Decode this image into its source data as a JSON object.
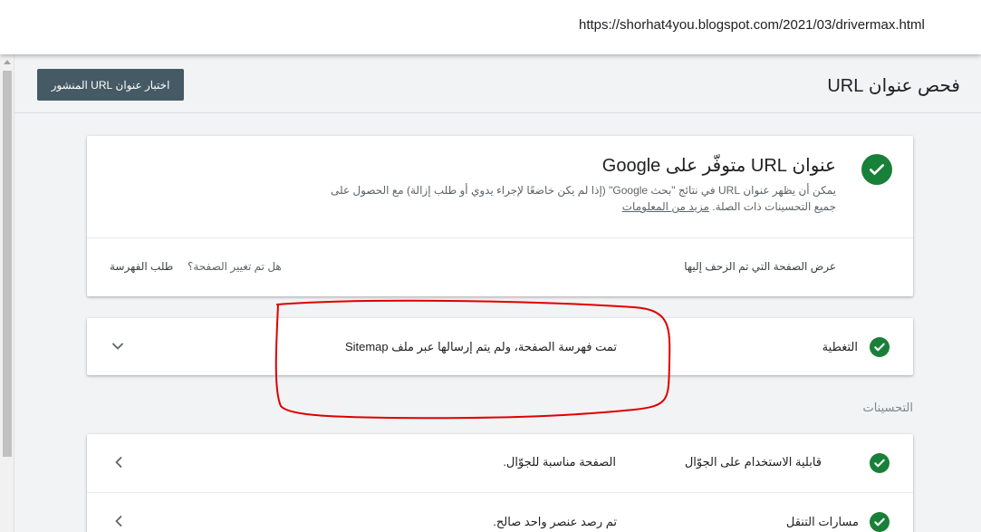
{
  "browser": {
    "url": "https://shorhat4you.blogspot.com/2021/03/drivermax.html"
  },
  "header": {
    "title": "فحص عنوان URL",
    "test_live_button": "اختبار عنوان URL المنشور"
  },
  "main_card": {
    "heading": "عنوان URL متوفّر على Google",
    "description": "يمكن أن يظهر عنوان URL في نتائج \"بحث Google\" (إذا لم يكن خاضعًا لإجراء يدوي أو طلب إزالة) مع الحصول على جميع التحسينات ذات الصلة.",
    "learn_more": "مزيد من المعلومات",
    "view_crawled": "عرض الصفحة التي تم الزحف إليها",
    "page_changed": "هل تم تغيير الصفحة؟",
    "request_indexing": "طلب الفهرسة"
  },
  "coverage": {
    "title": "التغطية",
    "value": "تمت فهرسة الصفحة، ولم يتم إرسالها عبر ملف Sitemap"
  },
  "enhancements": {
    "label": "التحسينات",
    "rows": [
      {
        "title": "قابلية الاستخدام على الجوّال",
        "value": "الصفحة مناسبة للجوّال."
      },
      {
        "title": "مسارات التنقل",
        "value": "تم رصد عنصر واحد صالح."
      }
    ]
  },
  "icons": {
    "status": "check-circle-icon",
    "expand": "chevron-down-icon",
    "open_row": "chevron-left-icon"
  },
  "colors": {
    "success": "#188038",
    "button_bg": "#455a64",
    "annotation": "#e00000",
    "page_bg": "#f1f3f4"
  }
}
